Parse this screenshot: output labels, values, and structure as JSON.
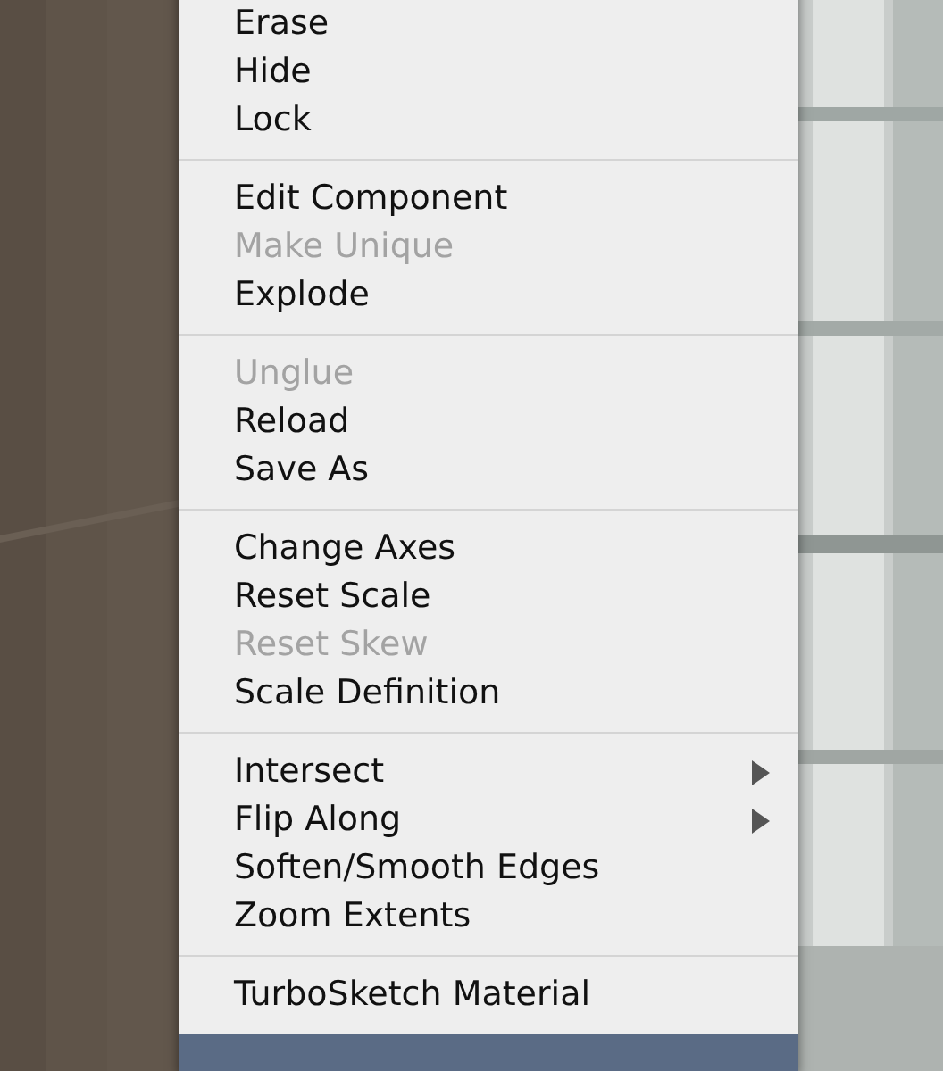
{
  "context_menu": {
    "groups": [
      {
        "items": [
          {
            "label": "Erase",
            "disabled": false,
            "kind": "command"
          },
          {
            "label": "Hide",
            "disabled": false,
            "kind": "command"
          },
          {
            "label": "Lock",
            "disabled": false,
            "kind": "command"
          }
        ]
      },
      {
        "items": [
          {
            "label": "Edit Component",
            "disabled": false,
            "kind": "command"
          },
          {
            "label": "Make Unique",
            "disabled": true,
            "kind": "command"
          },
          {
            "label": "Explode",
            "disabled": false,
            "kind": "command"
          }
        ]
      },
      {
        "items": [
          {
            "label": "Unglue",
            "disabled": true,
            "kind": "command"
          },
          {
            "label": "Reload",
            "disabled": false,
            "kind": "command"
          },
          {
            "label": "Save As",
            "disabled": false,
            "kind": "command"
          }
        ]
      },
      {
        "items": [
          {
            "label": "Change Axes",
            "disabled": false,
            "kind": "command"
          },
          {
            "label": "Reset Scale",
            "disabled": false,
            "kind": "command"
          },
          {
            "label": "Reset Skew",
            "disabled": true,
            "kind": "command"
          },
          {
            "label": "Scale Definition",
            "disabled": false,
            "kind": "command"
          }
        ]
      },
      {
        "items": [
          {
            "label": "Intersect",
            "disabled": false,
            "kind": "submenu"
          },
          {
            "label": "Flip Along",
            "disabled": false,
            "kind": "submenu"
          },
          {
            "label": "Soften/Smooth Edges",
            "disabled": false,
            "kind": "command"
          },
          {
            "label": "Zoom Extents",
            "disabled": false,
            "kind": "command"
          }
        ]
      },
      {
        "items": [
          {
            "label": "TurboSketch Material",
            "disabled": false,
            "kind": "command"
          }
        ]
      }
    ]
  }
}
